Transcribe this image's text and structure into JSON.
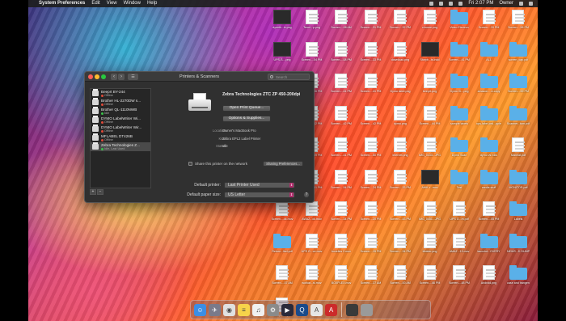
{
  "menubar": {
    "apple": "",
    "app_name": "System Preferences",
    "menus": [
      "Edit",
      "View",
      "Window",
      "Help"
    ],
    "clock": "Fri 2:07 PM",
    "user": "Owner"
  },
  "window": {
    "title": "Printers & Scanners",
    "search_placeholder": "Search",
    "printers": [
      {
        "name": "Beeprt BY-244",
        "status": "Offline",
        "status_color": "#e04a3a",
        "selected": false
      },
      {
        "name": "Brother HL-2270DW s...",
        "status": "Offline",
        "status_color": "#e04a3a",
        "selected": false
      },
      {
        "name": "Brother QL-1110NWB",
        "status": "Idle",
        "status_color": "#3cc24a",
        "selected": false
      },
      {
        "name": "DYMO LabelWriter Wi...",
        "status": "Offline",
        "status_color": "#e04a3a",
        "selected": false
      },
      {
        "name": "DYMO LabelWriter Wir...",
        "status": "Offline",
        "status_color": "#e04a3a",
        "selected": false
      },
      {
        "name": "MFLABEL DT426B",
        "status": "Offline",
        "status_color": "#e04a3a",
        "selected": false
      },
      {
        "name": "Zebra Technologies Z...",
        "status": "Idle, Last Used",
        "status_color": "#3cc24a",
        "selected": true
      }
    ],
    "add_label": "+",
    "remove_label": "−",
    "detail": {
      "name": "Zebra Technologies ZTC ZP 450-200dpi",
      "open_queue": "Open Print Queue...",
      "options": "Options & Supplies...",
      "location_label": "Location:",
      "location": "Owner's MacBook Pro",
      "kind_label": "Kind:",
      "kind": "Zebra EPL2 Label Printer",
      "status_label": "Status:",
      "status": "Idle"
    },
    "share_label": "Share this printer on the network",
    "sharing_prefs": "Sharing Preferences...",
    "default_printer_label": "Default printer:",
    "default_printer": "Last Printer Used",
    "paper_size_label": "Default paper size:",
    "paper_size": "US Letter",
    "help": "?"
  },
  "desktop": {
    "icons": [
      {
        "label": "dyeetk...in.png",
        "kind": "dark"
      },
      {
        "label": "Termi...p.png",
        "kind": "doc"
      },
      {
        "label": "Screen....08 AM",
        "kind": "doc"
      },
      {
        "label": "Screen....31 PM",
        "kind": "doc"
      },
      {
        "label": "Screen....32 PM",
        "kind": "doc"
      },
      {
        "label": "chrome.png",
        "kind": "doc"
      },
      {
        "label": "Video Electron",
        "kind": "folder"
      },
      {
        "label": "Screen....20 PM",
        "kind": "doc"
      },
      {
        "label": "Screen....58 PM",
        "kind": "doc"
      },
      {
        "label": "UPS-S....png",
        "kind": "dark"
      },
      {
        "label": "Screen....04 PM",
        "kind": "doc"
      },
      {
        "label": "Screen....08 PM",
        "kind": "doc"
      },
      {
        "label": "Screen....33 PM",
        "kind": "doc"
      },
      {
        "label": "download.png",
        "kind": "doc"
      },
      {
        "label": "Storyb...ts.indd",
        "kind": "dark"
      },
      {
        "label": "Screen....41 PM",
        "kind": "folder"
      },
      {
        "label": "ALL",
        "kind": "folder"
      },
      {
        "label": "screen_cap.pdf",
        "kind": "folder"
      },
      {
        "label": "4x6 test.png",
        "kind": "doc"
      },
      {
        "label": "Screen....36 PM",
        "kind": "doc"
      },
      {
        "label": "Screen....41 PM",
        "kind": "doc"
      },
      {
        "label": "Screen....41 PM",
        "kind": "doc"
      },
      {
        "label": "Dymo label.png",
        "kind": "doc"
      },
      {
        "label": "beeprt.png",
        "kind": "doc"
      },
      {
        "label": "Dymo Ill....png",
        "kind": "folder"
      },
      {
        "label": "amazon-...e-copy",
        "kind": "folder"
      },
      {
        "label": "Screen....59 PM",
        "kind": "folder"
      },
      {
        "label": "amazon...ips.png",
        "kind": "dark"
      },
      {
        "label": "Screen....42 PM",
        "kind": "doc"
      },
      {
        "label": "Screen....42 PM",
        "kind": "doc"
      },
      {
        "label": "Screen....42 PM",
        "kind": "doc"
      },
      {
        "label": "dymo.png",
        "kind": "doc"
      },
      {
        "label": "Screen....44 PM",
        "kind": "doc"
      },
      {
        "label": "sample labels",
        "kind": "folder"
      },
      {
        "label": "ups-label-ord...pple",
        "kind": "folder"
      },
      {
        "label": "Scanner...tom.pdf",
        "kind": "folder"
      },
      {
        "label": "Amazon...ltm.png",
        "kind": "doc"
      },
      {
        "label": "Screen....39 PM",
        "kind": "doc"
      },
      {
        "label": "Screen....41 PM",
        "kind": "doc"
      },
      {
        "label": "Screen....50 PM",
        "kind": "doc"
      },
      {
        "label": "internet.png",
        "kind": "doc"
      },
      {
        "label": "IMG_0433...JPG",
        "kind": "doc"
      },
      {
        "label": "Dymo Scan",
        "kind": "folder"
      },
      {
        "label": "dymo vs rollo",
        "kind": "folder"
      },
      {
        "label": "Maneat.pdf",
        "kind": "doc"
      },
      {
        "label": "Screen....48 PM",
        "kind": "doc"
      },
      {
        "label": "Screen....51 PM",
        "kind": "doc"
      },
      {
        "label": "Screen....54 PM",
        "kind": "doc"
      },
      {
        "label": "Screen....24 PM",
        "kind": "doc"
      },
      {
        "label": "Screen....33 PM",
        "kind": "doc"
      },
      {
        "label": "AWK-r...mov",
        "kind": "dark"
      },
      {
        "label": "Test",
        "kind": "folder"
      },
      {
        "label": "media stuff",
        "kind": "folder"
      },
      {
        "label": "MONITOR.pdf",
        "kind": "folder"
      },
      {
        "label": "Screen....ck.mov",
        "kind": "doc"
      },
      {
        "label": "AWAZ...ck.mov",
        "kind": "doc"
      },
      {
        "label": "Screen....34 PM",
        "kind": "doc"
      },
      {
        "label": "Screen....20 PM",
        "kind": "doc"
      },
      {
        "label": "Screen....43 PM",
        "kind": "doc"
      },
      {
        "label": "IMG_0451...JPG",
        "kind": "doc"
      },
      {
        "label": "UPS G...m.pdf",
        "kind": "doc"
      },
      {
        "label": "Screen....05 PM",
        "kind": "doc"
      },
      {
        "label": "Labels",
        "kind": "folder"
      },
      {
        "label": "Return...lbel.pdf",
        "kind": "folder"
      },
      {
        "label": "UPS G...ce.mov",
        "kind": "doc"
      },
      {
        "label": "boxelles 2.mov",
        "kind": "doc"
      },
      {
        "label": "Screen....15 PM",
        "kind": "doc"
      },
      {
        "label": "Screen....34 PM",
        "kind": "doc"
      },
      {
        "label": "ttfolder.png",
        "kind": "doc"
      },
      {
        "label": "AMAZ...13.mov",
        "kind": "doc"
      },
      {
        "label": "launchd...OVERY",
        "kind": "folder"
      },
      {
        "label": "NEWS...D DUMP",
        "kind": "folder"
      },
      {
        "label": "Screen....07 AM",
        "kind": "doc"
      },
      {
        "label": "workar...st.mov",
        "kind": "doc"
      },
      {
        "label": "BOXPLEX.mov",
        "kind": "doc"
      },
      {
        "label": "Screen....37 AM",
        "kind": "doc"
      },
      {
        "label": "Screen....00 AM",
        "kind": "doc"
      },
      {
        "label": "Screen....46 PM",
        "kind": "doc"
      },
      {
        "label": "Screen....48 PM",
        "kind": "doc"
      },
      {
        "label": "Android.png",
        "kind": "doc"
      },
      {
        "label": "case and trangen",
        "kind": "folder"
      },
      {
        "label": "Sampl...ck.pdf",
        "kind": "doc"
      }
    ]
  },
  "dock": {
    "apps": [
      {
        "name": "finder-icon",
        "color": "#3a8ee6",
        "glyph": "☺"
      },
      {
        "name": "launchpad-icon",
        "color": "#7a7a8a",
        "glyph": "✈"
      },
      {
        "name": "chrome-icon",
        "color": "#e0e0e0",
        "glyph": "◉"
      },
      {
        "name": "notes-icon",
        "color": "#f6d34a",
        "glyph": "≡"
      },
      {
        "name": "music-icon",
        "color": "#f0f0f0",
        "glyph": "♫"
      },
      {
        "name": "system-preferences-icon",
        "color": "#8a8a8a",
        "glyph": "⚙"
      },
      {
        "name": "final-cut-icon",
        "color": "#2a2a3a",
        "glyph": "▶"
      },
      {
        "name": "quicktime-icon",
        "color": "#1a4a8a",
        "glyph": "Q"
      },
      {
        "name": "acrobat-icon",
        "color": "#e6e6e6",
        "glyph": "A"
      },
      {
        "name": "acrobat-reader-icon",
        "color": "#cc2a2a",
        "glyph": "A"
      }
    ],
    "tray": [
      {
        "name": "downloads-stack-icon",
        "color": "#3a3a3a"
      },
      {
        "name": "trash-icon",
        "color": "#9a9a9a"
      }
    ]
  }
}
